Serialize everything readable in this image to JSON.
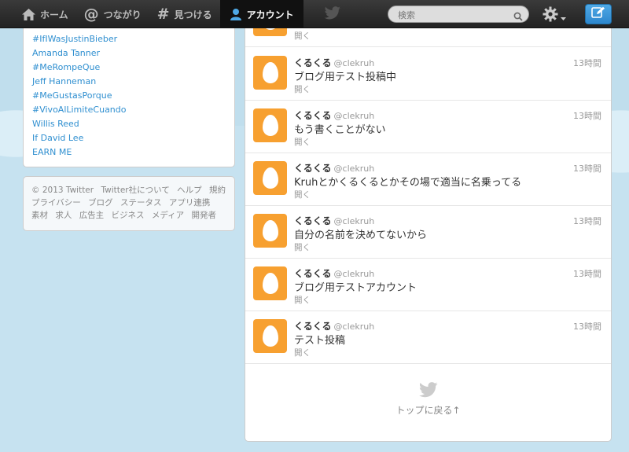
{
  "nav": {
    "home": "ホーム",
    "connect": "つながり",
    "discover": "見つける",
    "account": "アカウント"
  },
  "search": {
    "placeholder": "検索"
  },
  "trends": [
    "#IfIWasJustinBieber",
    "Amanda Tanner",
    "#MeRompeQue",
    "Jeff Hanneman",
    "#MeGustasPorque",
    "#VivoAlLimiteCuando",
    "Willis Reed",
    "If David Lee",
    "EARN ME"
  ],
  "footer": {
    "copyright": "© 2013 Twitter",
    "links_row1": [
      "Twitter社について",
      "ヘルプ",
      "規約"
    ],
    "links_row2": [
      "プライバシー",
      "ブログ",
      "ステータス",
      "アプリ連携"
    ],
    "links_row3": [
      "素材",
      "求人",
      "広告主",
      "ビジネス",
      "メディア",
      "開発者"
    ]
  },
  "partial_tweet": {
    "open": "開く"
  },
  "tweets": [
    {
      "name": "くるくる",
      "handle": "@clekruh",
      "time": "13時間",
      "text": "ブログ用テスト投稿中",
      "open": "開く"
    },
    {
      "name": "くるくる",
      "handle": "@clekruh",
      "time": "13時間",
      "text": "もう書くことがない",
      "open": "開く"
    },
    {
      "name": "くるくる",
      "handle": "@clekruh",
      "time": "13時間",
      "text": "Kruhとかくるくるとかその場で適当に名乗ってる",
      "open": "開く"
    },
    {
      "name": "くるくる",
      "handle": "@clekruh",
      "time": "13時間",
      "text": "自分の名前を決めてないから",
      "open": "開く"
    },
    {
      "name": "くるくる",
      "handle": "@clekruh",
      "time": "13時間",
      "text": "ブログ用テストアカウント",
      "open": "開く"
    },
    {
      "name": "くるくる",
      "handle": "@clekruh",
      "time": "13時間",
      "text": "テスト投稿",
      "open": "開く"
    }
  ],
  "back_to_top": "トップに戻る↑",
  "colors": {
    "topbar": "#2b2b2b",
    "link": "#2f8fd0",
    "avatar": "#f7a030",
    "background": "#c0deed"
  }
}
